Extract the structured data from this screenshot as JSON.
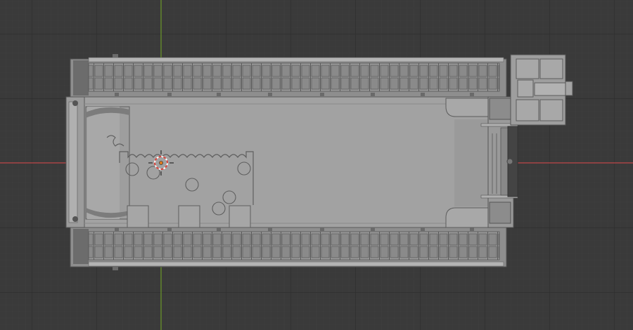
{
  "viewport": {
    "background": "#3a3a3a",
    "grid_minor_color": "#424242",
    "grid_major_color": "#2e2e2e",
    "x_axis_color": "#c0474a",
    "y_axis_color": "#6d9a2b"
  },
  "model": {
    "body_color": "#a2a2a2",
    "edge_color": "#585858",
    "track_color": "#8e8e8e",
    "shadow_color": "#747474"
  },
  "cursor": {
    "icon": "3d-cursor-icon",
    "accent": "#e07a1e"
  }
}
